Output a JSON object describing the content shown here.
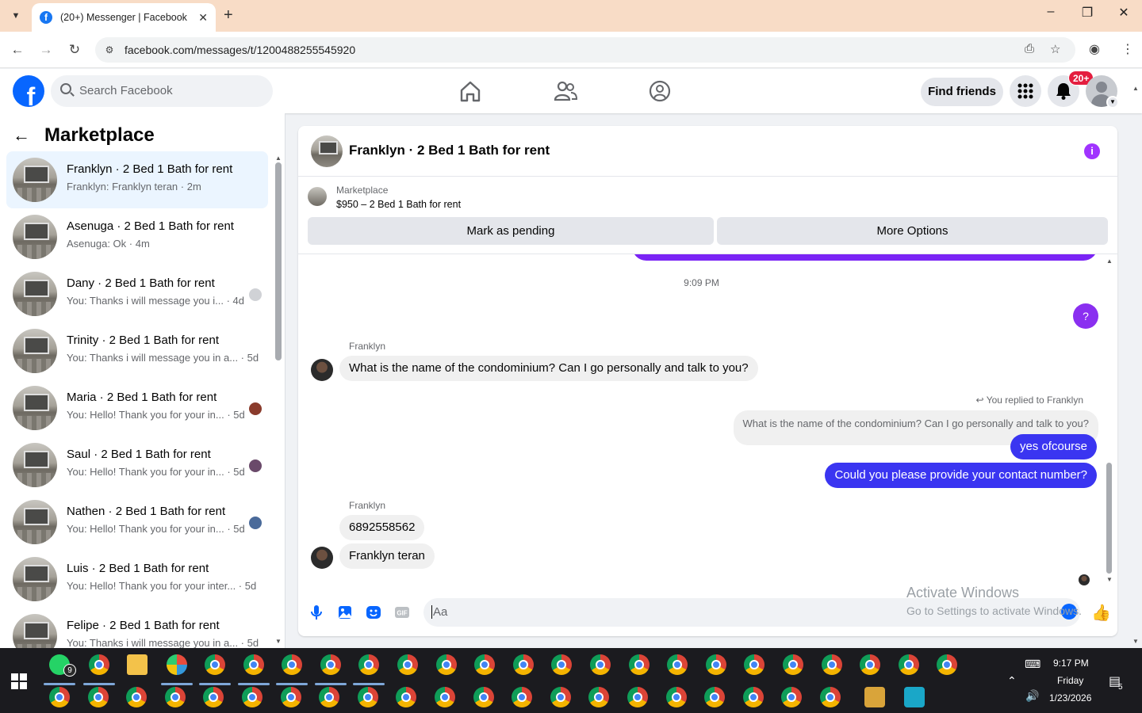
{
  "browser": {
    "tab_title": "(20+) Messenger | Facebook",
    "url": "facebook.com/messages/t/1200488255545920"
  },
  "facebook": {
    "logo": "f",
    "search_placeholder": "Search Facebook",
    "find_friends": "Find friends",
    "notification_badge": "20+"
  },
  "left_panel": {
    "title": "Marketplace",
    "chats": [
      {
        "name": "Franklyn · 2 Bed 1 Bath for rent",
        "preview": "Franklyn: Franklyn teran · 2m",
        "active": true,
        "mini": false
      },
      {
        "name": "Asenuga · 2 Bed 1 Bath for rent",
        "preview": "Asenuga: Ok · 4m",
        "active": false,
        "mini": false
      },
      {
        "name": "Dany · 2 Bed 1 Bath for rent",
        "preview": "You: Thanks i will message you i... · 4d",
        "active": false,
        "mini": true,
        "mini_color": "#d0d2d6"
      },
      {
        "name": "Trinity · 2 Bed 1 Bath for rent",
        "preview": "You: Thanks i will message you in a... · 5d",
        "active": false,
        "mini": false
      },
      {
        "name": "Maria · 2 Bed 1 Bath for rent",
        "preview": "You: Hello! Thank you for your in... · 5d",
        "active": false,
        "mini": true,
        "mini_color": "#8a3b2c"
      },
      {
        "name": "Saul · 2 Bed 1 Bath for rent",
        "preview": "You: Hello! Thank you for your in... · 5d",
        "active": false,
        "mini": true,
        "mini_color": "#6a4a6a"
      },
      {
        "name": "Nathen · 2 Bed 1 Bath for rent",
        "preview": "You: Hello! Thank you for your in... · 5d",
        "active": false,
        "mini": true,
        "mini_color": "#4a6a9a"
      },
      {
        "name": "Luis · 2 Bed 1 Bath for rent",
        "preview": "You: Hello! Thank you for your inter... · 5d",
        "active": false,
        "mini": false
      },
      {
        "name": "Felipe · 2 Bed 1 Bath for rent",
        "preview": "You: Thanks i will message you in a... · 5d",
        "active": false,
        "mini": false
      }
    ]
  },
  "conversation": {
    "title": "Franklyn · 2 Bed 1 Bath for rent",
    "info_icon": "i",
    "marketplace_label": "Marketplace",
    "listing": "$950 – 2 Bed 1 Bath for rent",
    "mark_pending": "Mark as pending",
    "more_options": "More Options",
    "timestamp": "9:09 PM",
    "question_bubble": "?",
    "sender1": "Franklyn",
    "msg_in_1": "What is the name of the condominium? Can I go personally and talk to you?",
    "reply_note": "You replied to Franklyn",
    "reply_quote": "What is the name of the condominium? Can I go personally and talk to you?",
    "msg_out_1": "yes ofcourse",
    "msg_out_2": "Could you please provide your contact number?",
    "sender2": "Franklyn",
    "msg_in_2": "6892558562",
    "msg_in_3": "Franklyn teran",
    "composer_placeholder": "Aa"
  },
  "watermark": {
    "line1": "Activate Windows",
    "line2": "Go to Settings to activate Windows."
  },
  "taskbar": {
    "whatsapp_badge": "9",
    "time": "9:17 PM",
    "day": "Friday",
    "date": "1/23/2026",
    "notification_count": "5"
  },
  "colors": {
    "facebook_blue": "#0866ff",
    "outgoing_bubble": "#3a35f1",
    "info_purple": "#a033ff",
    "badge_red": "#e41e3f"
  }
}
